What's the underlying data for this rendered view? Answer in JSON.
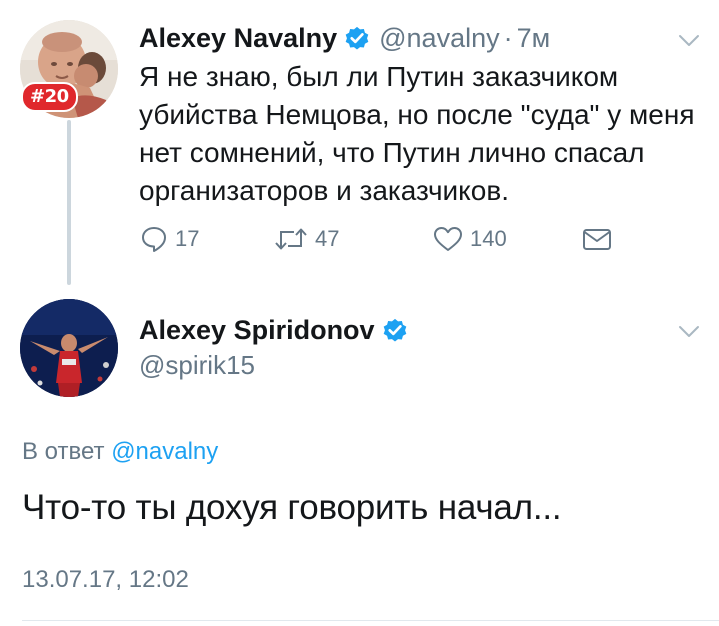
{
  "tweet": {
    "author_name": "Alexey Navalny",
    "author_handle": "@navalny",
    "separator": "·",
    "time_ago": "7м",
    "avatar_badge": "#20",
    "text": "Я не знаю, был ли Путин заказчиком убийства Немцова, но после \"суда\" у меня нет сомнений, что Путин лично спасал организаторов и заказчиков.",
    "replies": "17",
    "retweets": "47",
    "likes": "140"
  },
  "reply": {
    "author_name": "Alexey Spiridonov",
    "author_handle": "@spirik15",
    "reply_prefix": "В ответ",
    "reply_mention": "@navalny",
    "text": "Что-то ты дохуя говорить начал...",
    "datetime": "13.07.17, 12:02"
  },
  "colors": {
    "text_primary": "#14171a",
    "text_secondary": "#657786",
    "link": "#1da1f2",
    "verified": "#1da1f2",
    "badge": "#e0282c",
    "thread_line": "#ccd6dd"
  },
  "icons": {
    "verified": "verified-badge-icon",
    "menu": "chevron-down-icon",
    "reply": "speech-bubble-icon",
    "retweet": "retweet-arrows-icon",
    "like": "heart-icon",
    "message": "envelope-icon"
  }
}
